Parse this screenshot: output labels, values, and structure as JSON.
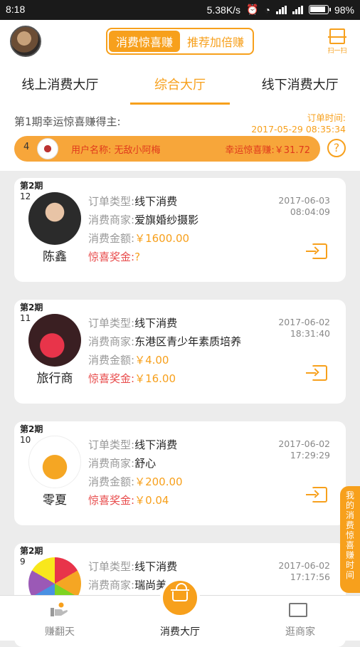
{
  "status_bar": {
    "time": "8:18",
    "speed": "5.38K/s",
    "battery": "98%"
  },
  "header": {
    "switch_active": "消费惊喜赚",
    "switch_inactive": "推荐加倍赚",
    "scan_label": "扫一扫"
  },
  "tabs": [
    "线上消费大厅",
    "综合大厅",
    "线下消费大厅"
  ],
  "winner": {
    "title": "第1期幸运惊喜赚得主:",
    "order_time_label": "订单时间:",
    "order_time": "2017-05-29 08:35:34",
    "rank": "4",
    "user_name": "用户名称: 无敌小阿梅",
    "lucky_amount": "幸运惊喜赚:￥31.72",
    "help": "?"
  },
  "labels": {
    "order_type": "订单类型:",
    "merchant": "消费商家:",
    "amount": "消费金额:",
    "bonus": "惊喜奖金:"
  },
  "orders": [
    {
      "period": "第2期",
      "count": "12",
      "user": "陈鑫",
      "type": "线下消费",
      "merchant": "爱旗婚纱摄影",
      "amount": "￥1600.00",
      "bonus": "?",
      "date": "2017-06-03",
      "time": "08:04:09"
    },
    {
      "period": "第2期",
      "count": "11",
      "user": "旅行商",
      "type": "线下消费",
      "merchant": "东港区青少年素质培养",
      "amount": "￥4.00",
      "bonus": "￥16.00",
      "date": "2017-06-02",
      "time": "18:31:40"
    },
    {
      "period": "第2期",
      "count": "10",
      "user": "零夏",
      "type": "线下消费",
      "merchant": "舒心",
      "amount": "￥200.00",
      "bonus": "￥0.04",
      "date": "2017-06-02",
      "time": "17:29:29"
    },
    {
      "period": "第2期",
      "count": "9",
      "user": "",
      "type": "线下消费",
      "merchant": "瑞尚美",
      "amount": "",
      "bonus": "",
      "date": "2017-06-02",
      "time": "17:17:56"
    }
  ],
  "side_tab": [
    "我",
    "的",
    "消",
    "费",
    "惊",
    "喜",
    "赚",
    "时",
    "间"
  ],
  "bottom_nav": [
    "赚翻天",
    "消费大厅",
    "逛商家"
  ],
  "colors": {
    "accent": "#f7a01c",
    "bonus_red": "#e84b4b",
    "winner_text": "#e03a1c"
  }
}
